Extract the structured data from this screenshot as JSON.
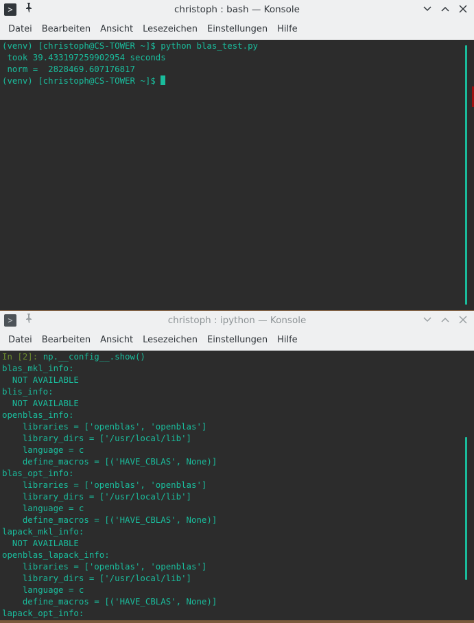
{
  "window_top": {
    "title": "christoph : bash — Konsole",
    "app_icon_glyph": ">",
    "pin_glyph": "📌",
    "menu": [
      "Datei",
      "Bearbeiten",
      "Ansicht",
      "Lesezeichen",
      "Einstellungen",
      "Hilfe"
    ],
    "terminal": {
      "prompt_line": "(venv) [christoph@CS-TOWER ~]$ python blas_test.py",
      "output": [
        " took 39.433197259902954 seconds",
        " norm =  2828469.607176817"
      ],
      "current_prompt": "(venv) [christoph@CS-TOWER ~]$ "
    }
  },
  "window_bottom": {
    "title": "christoph : ipython — Konsole",
    "app_icon_glyph": ">",
    "pin_glyph": "📌",
    "menu": [
      "Datei",
      "Bearbeiten",
      "Ansicht",
      "Lesezeichen",
      "Einstellungen",
      "Hilfe"
    ],
    "terminal": {
      "in_prompt": "In [2]: ",
      "command": "np.__config__.show()",
      "lines": [
        "blas_mkl_info:",
        "  NOT AVAILABLE",
        "blis_info:",
        "  NOT AVAILABLE",
        "openblas_info:",
        "    libraries = ['openblas', 'openblas']",
        "    library_dirs = ['/usr/local/lib']",
        "    language = c",
        "    define_macros = [('HAVE_CBLAS', None)]",
        "blas_opt_info:",
        "    libraries = ['openblas', 'openblas']",
        "    library_dirs = ['/usr/local/lib']",
        "    language = c",
        "    define_macros = [('HAVE_CBLAS', None)]",
        "lapack_mkl_info:",
        "  NOT AVAILABLE",
        "openblas_lapack_info:",
        "    libraries = ['openblas', 'openblas']",
        "    library_dirs = ['/usr/local/lib']",
        "    language = c",
        "    define_macros = [('HAVE_CBLAS', None)]",
        "lapack_opt_info:"
      ]
    }
  },
  "colors": {
    "terminal_text": "#1abc9c",
    "terminal_bg": "#2c2c2c",
    "titlebar_bg": "#eff0f1",
    "ipython_prompt": "#6c8c2e"
  }
}
